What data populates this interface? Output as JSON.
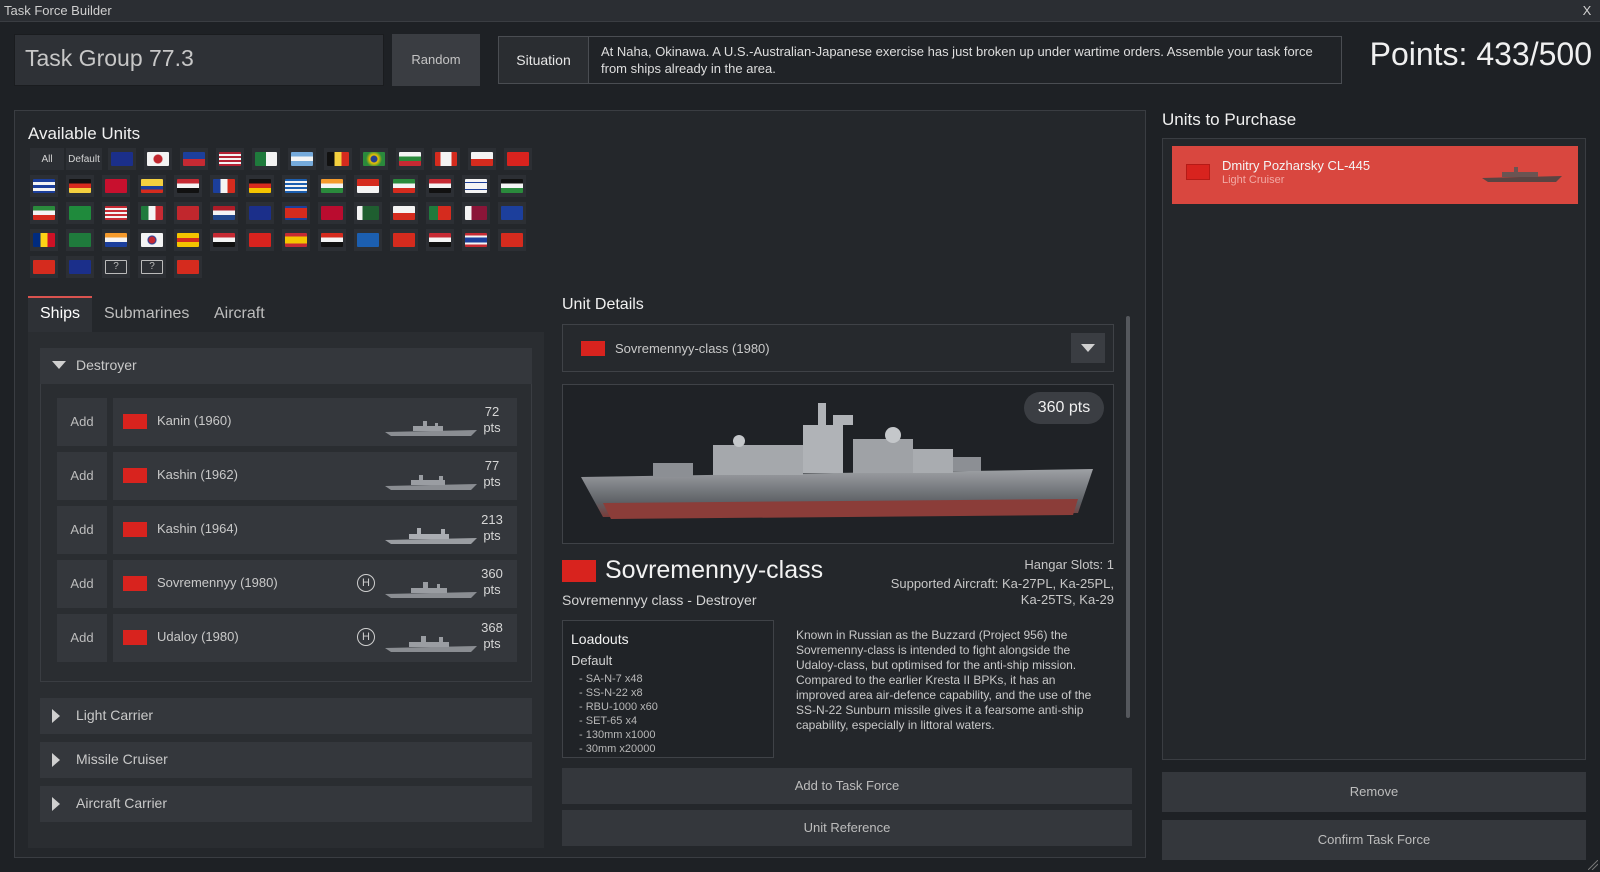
{
  "window": {
    "title": "Task Force Builder",
    "close_label": "X"
  },
  "header": {
    "task_group_name": "Task Group 77.3",
    "random_label": "Random",
    "situation_label": "Situation",
    "situation_text": "At Naha, Okinawa. A U.S.-Australian-Japanese exercise has just broken up under wartime orders. Assemble your task force from ships already in the area.",
    "points": "Points: 433/500"
  },
  "available_units": {
    "title": "Available Units",
    "filter_all": "All",
    "filter_default": "Default"
  },
  "tabs": [
    "Ships",
    "Submarines",
    "Aircraft"
  ],
  "categories": {
    "destroyer": "Destroyer",
    "light_carrier": "Light Carrier",
    "missile_cruiser": "Missile Cruiser",
    "aircraft_carrier": "Aircraft Carrier"
  },
  "units": [
    {
      "add": "Add",
      "name": "Kanin (1960)",
      "pts": "72",
      "unit": "pts"
    },
    {
      "add": "Add",
      "name": "Kashin (1962)",
      "pts": "77",
      "unit": "pts"
    },
    {
      "add": "Add",
      "name": "Kashin (1964)",
      "pts": "213",
      "unit": "pts"
    },
    {
      "add": "Add",
      "name": "Sovremennyy (1980)",
      "pts": "360",
      "unit": "pts",
      "badge": "H"
    },
    {
      "add": "Add",
      "name": "Udaloy (1980)",
      "pts": "368",
      "unit": "pts",
      "badge": "H"
    }
  ],
  "unit_details": {
    "title": "Unit Details",
    "selected": "Sovremennyy-class (1980)",
    "points_badge": "360 pts",
    "name": "Sovremennyy-class",
    "subtitle": "Sovremennyy class - Destroyer",
    "hangar": "Hangar Slots: 1",
    "supported_aircraft_1": "Supported Aircraft: Ka-27PL, Ka-25PL,",
    "supported_aircraft_2": "Ka-25TS, Ka-29",
    "loadouts_title": "Loadouts",
    "loadout_default": "Default",
    "loadout_items": [
      "SA-N-7 x48",
      "SS-N-22 x8",
      "RBU-1000 x60",
      "SET-65 x4",
      "130mm x1000",
      "30mm x20000"
    ],
    "description": "Known in Russian as the Buzzard (Project 956) the Sovremenny-class is intended to fight alongside the Udaloy-class, but optimised for the anti-ship mission. Compared to the earlier Kresta II BPKs, it has an improved area air-defence capability, and the use of the SS-N-22 Sunburn missile gives it a fearsome anti-ship capability, especially in littoral waters.",
    "add_button": "Add to Task Force",
    "reference_button": "Unit Reference"
  },
  "purchase": {
    "title": "Units to Purchase",
    "items": [
      {
        "name": "Dmitry Pozharsky CL-445",
        "type": "Light Cruiser"
      }
    ],
    "remove_button": "Remove",
    "confirm_button": "Confirm Task Force"
  },
  "colors": {
    "accent": "#d9473f",
    "soviet_red": "#d8231e",
    "bg": "#1e2125"
  }
}
